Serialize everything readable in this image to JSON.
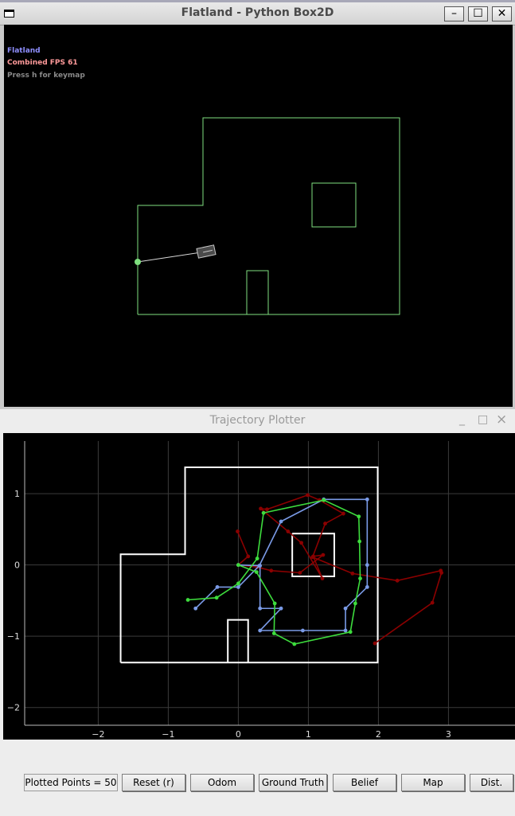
{
  "flatland": {
    "title": "Flatland - Python Box2D",
    "hud": {
      "line1": "Flatland",
      "line2": "Combined FPS 61",
      "line3": "Press h for keymap"
    },
    "controls": {
      "minimize": "–",
      "maximize": "☐",
      "close": "✕"
    }
  },
  "plotter": {
    "title": "Trajectory Plotter",
    "controls": {
      "minimize": "_",
      "maximize": "□",
      "close": "×"
    },
    "plotted_points_label": "Plotted Points = 50",
    "buttons": {
      "reset": "Reset (r)",
      "odom": "Odom",
      "ground_truth": "Ground Truth",
      "belief": "Belief",
      "map": "Map",
      "dist": "Dist."
    }
  },
  "chart_data": {
    "type": "line",
    "x_ticks": [
      -2,
      -1,
      0,
      1,
      2,
      3
    ],
    "y_ticks": [
      1,
      0,
      -1,
      -2
    ],
    "xlim": [
      -3.05,
      3.95
    ],
    "ylim": [
      -2.45,
      1.85
    ],
    "grid": true,
    "map_outline": [
      [
        -1.68,
        -1.37
      ],
      [
        -1.68,
        0.15
      ],
      [
        -0.76,
        0.15
      ],
      [
        -0.76,
        1.37
      ],
      [
        1.99,
        1.37
      ],
      [
        1.99,
        -1.37
      ],
      [
        -1.68,
        -1.37
      ]
    ],
    "map_obstacles": [
      [
        [
          0.77,
          0.44
        ],
        [
          1.37,
          0.44
        ],
        [
          1.37,
          -0.16
        ],
        [
          0.77,
          -0.16
        ],
        [
          0.77,
          0.44
        ]
      ],
      [
        [
          -0.15,
          -1.37
        ],
        [
          -0.15,
          -0.77
        ],
        [
          0.14,
          -0.77
        ],
        [
          0.14,
          -1.37
        ]
      ]
    ],
    "series": [
      {
        "color": "#8b0000",
        "points": [
          [
            -0.01,
            0.47
          ],
          [
            0.14,
            0.12
          ],
          [
            0.0,
            0.0
          ],
          [
            0.27,
            -0.03
          ],
          [
            0.47,
            -0.08
          ],
          [
            0.88,
            -0.11
          ],
          [
            1.21,
            0.14
          ],
          [
            1.07,
            0.12
          ],
          [
            1.2,
            -0.19
          ],
          [
            0.9,
            0.31
          ],
          [
            0.71,
            0.47
          ],
          [
            0.32,
            0.79
          ],
          [
            0.41,
            0.78
          ],
          [
            0.99,
            0.98
          ],
          [
            1.16,
            0.91
          ],
          [
            1.5,
            0.72
          ],
          [
            1.24,
            0.58
          ],
          [
            1.06,
            0.11
          ],
          [
            1.63,
            -0.12
          ],
          [
            2.27,
            -0.22
          ],
          [
            2.89,
            -0.08
          ],
          [
            2.9,
            -0.11
          ],
          [
            2.77,
            -0.53
          ],
          [
            1.95,
            -1.1
          ]
        ]
      },
      {
        "color": "#7a9ae6",
        "points": [
          [
            -0.61,
            -0.61
          ],
          [
            -0.3,
            -0.31
          ],
          [
            0.0,
            -0.31
          ],
          [
            0.3,
            -0.01
          ],
          [
            0.61,
            0.61
          ],
          [
            1.22,
            0.92
          ],
          [
            1.84,
            0.92
          ],
          [
            1.84,
            0.0
          ],
          [
            1.84,
            -0.31
          ],
          [
            1.53,
            -0.61
          ],
          [
            1.53,
            -0.92
          ],
          [
            0.92,
            -0.92
          ],
          [
            0.31,
            -0.92
          ],
          [
            0.61,
            -0.61
          ],
          [
            0.31,
            -0.61
          ],
          [
            0.31,
            -0.01
          ],
          [
            0.0,
            0.0
          ]
        ]
      },
      {
        "color": "#3ddc3d",
        "points": [
          [
            -0.72,
            -0.49
          ],
          [
            -0.31,
            -0.46
          ],
          [
            0.0,
            -0.26
          ],
          [
            0.27,
            0.09
          ],
          [
            0.36,
            0.73
          ],
          [
            1.22,
            0.91
          ],
          [
            1.72,
            0.68
          ],
          [
            1.73,
            0.33
          ],
          [
            1.74,
            -0.19
          ],
          [
            1.67,
            -0.54
          ],
          [
            1.6,
            -0.94
          ],
          [
            0.8,
            -1.11
          ],
          [
            0.51,
            -0.96
          ],
          [
            0.52,
            -0.54
          ],
          [
            0.26,
            -0.1
          ],
          [
            0.0,
            0.0
          ]
        ]
      }
    ]
  }
}
